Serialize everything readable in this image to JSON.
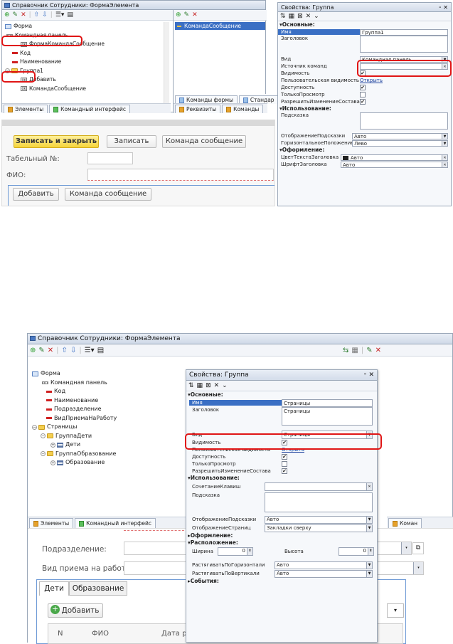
{
  "s1": {
    "title": "Справочник Сотрудники: ФормаЭлемента",
    "tree": [
      {
        "label": "Форма",
        "icon": "form-icon",
        "indent": 0
      },
      {
        "label": "Командная панель",
        "icon": "command-panel-icon",
        "indent": 1
      },
      {
        "label": "ФормаКомандаСообщение",
        "icon": "command-icon",
        "indent": 2
      },
      {
        "label": "Код",
        "icon": "field-icon",
        "indent": 1
      },
      {
        "label": "Наименование",
        "icon": "field-icon",
        "indent": 1
      },
      {
        "label": "Группа1",
        "icon": "folder-icon",
        "indent": 1
      },
      {
        "label": "Добавить",
        "icon": "command-icon",
        "indent": 2
      },
      {
        "label": "КомандаСообщение",
        "icon": "command-icon",
        "indent": 2
      }
    ],
    "left_tabs": [
      "Элементы",
      "Командный интерфейс"
    ],
    "cmd_list": [
      "КомандаСообщение"
    ],
    "mid_subtabs": [
      "Команды формы",
      "Стандар"
    ],
    "mid_tabs": [
      "Реквизиты",
      "Команды"
    ],
    "props": {
      "title": "Свойства: Группа",
      "s_basic": "Основные:",
      "name_label": "Имя",
      "name_value": "Группа1",
      "header_label": "Заголовок",
      "view_label": "Вид",
      "view_value": "Командная панель",
      "cmdsrc_label": "Источник команд",
      "visible_label": "Видимость",
      "uservis_label": "Пользовательская видимость",
      "uservis_link": "Открыть",
      "enabled_label": "Доступность",
      "readonly_label": "ТолькоПросмотр",
      "allowchg_label": "РазрешитьИзменениеСостава",
      "s_use": "Использование:",
      "hint_label": "Подсказка",
      "showhint_label": "ОтображениеПодсказки",
      "showhint_value": "Авто",
      "hpos_label": "ГоризонтальноеПоложение",
      "hpos_value": "Лево",
      "s_design": "Оформление:",
      "hdrcolor_label": "ЦветТекстаЗаголовка",
      "hdrcolor_value": "Авто",
      "hdrfont_label": "ШрифтЗаголовка",
      "hdrfont_value": "Авто"
    },
    "form": {
      "save_close": "Записать и закрыть",
      "save": "Записать",
      "cmd_msg": "Команда сообщение",
      "tabnum_label": "Табельный №:",
      "fio_label": "ФИО:",
      "add": "Добавить",
      "cmd_msg2": "Команда сообщение"
    }
  },
  "s2": {
    "title": "Справочник Сотрудники: ФормаЭлемента",
    "tree": [
      {
        "label": "Форма",
        "icon": "form-icon",
        "indent": 0
      },
      {
        "label": "Командная панель",
        "icon": "command-panel-icon",
        "indent": 1
      },
      {
        "label": "Код",
        "icon": "field-icon",
        "indent": 1
      },
      {
        "label": "Наименование",
        "icon": "field-icon",
        "indent": 1
      },
      {
        "label": "Подразделение",
        "icon": "field-icon",
        "indent": 1
      },
      {
        "label": "ВидПриемаНаРаботу",
        "icon": "field-icon",
        "indent": 1
      },
      {
        "label": "Страницы",
        "icon": "folder-icon",
        "indent": 0
      },
      {
        "label": "ГруппаДети",
        "icon": "folder-icon",
        "indent": 1
      },
      {
        "label": "Дети",
        "icon": "table-icon",
        "indent": 2
      },
      {
        "label": "ГруппаОбразование",
        "icon": "folder-icon",
        "indent": 1
      },
      {
        "label": "Образование",
        "icon": "table-icon",
        "indent": 2
      }
    ],
    "left_tabs": [
      "Элементы",
      "Командный интерфейс"
    ],
    "right_tab": "Коман",
    "props": {
      "title": "Свойства: Группа",
      "s_basic": "Основные:",
      "name_label": "Имя",
      "name_value": "Страницы",
      "header_label": "Заголовок",
      "header_value": "Страницы",
      "view_label": "Вид",
      "view_value": "Страницы",
      "visible_label": "Видимость",
      "uservis_label": "Пользовательская видимость",
      "uservis_link": "Открыть",
      "enabled_label": "Доступность",
      "readonly_label": "ТолькоПросмотр",
      "allowchg_label": "РазрешитьИзменениеСостава",
      "s_use": "Использование:",
      "shortcut_label": "СочетаниеКлавиш",
      "hint_label": "Подсказка",
      "showhint_label": "ОтображениеПодсказки",
      "showhint_value": "Авто",
      "showpages_label": "ОтображениеСтраниц",
      "showpages_value": "Закладки сверху",
      "s_design": "Оформление:",
      "s_layout": "Расположение:",
      "width_label": "Ширина",
      "width_value": "0",
      "height_label": "Высота",
      "height_value": "0",
      "hstretch_label": "РастягиватьПоГоризонтали",
      "hstretch_value": "Авто",
      "vstretch_label": "РастягиватьПоВертикали",
      "vstretch_value": "Авто",
      "s_events": "События:"
    },
    "form": {
      "dept_label": "Подразделение:",
      "hire_label": "Вид приема на работу:",
      "tab_kids": "Дети",
      "tab_edu": "Образование",
      "add": "Добавить",
      "col_n": "N",
      "col_fio": "ФИО",
      "col_date": "Дата р"
    }
  }
}
